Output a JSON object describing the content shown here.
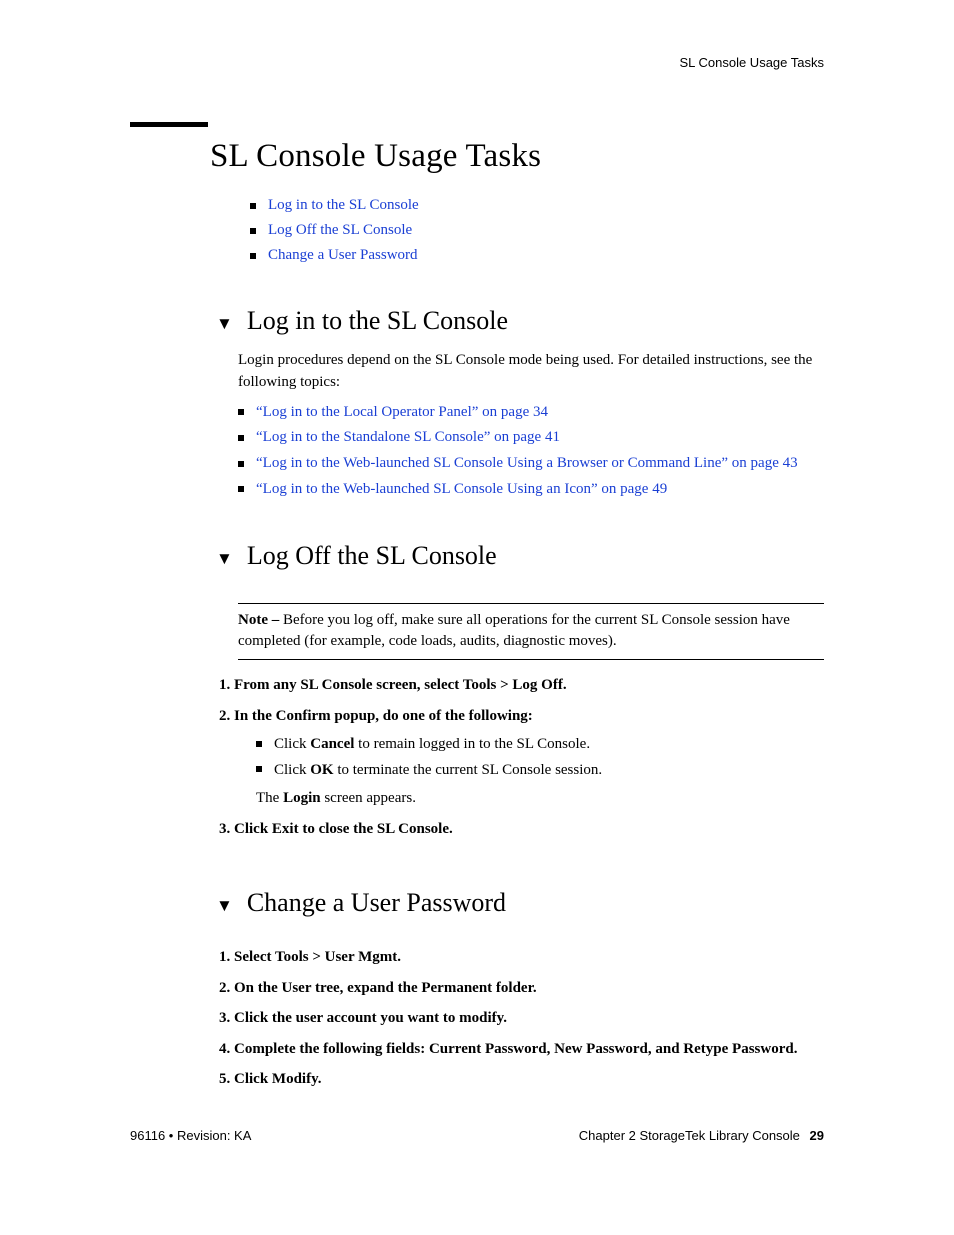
{
  "running_header": "SL Console Usage Tasks",
  "title": "SL Console Usage Tasks",
  "toc_links": [
    "Log in to the SL Console",
    "Log Off the SL Console",
    "Change a User Password"
  ],
  "section_login": {
    "heading": "Log in to the SL Console",
    "intro": "Login procedures depend on the SL Console mode being used. For detailed instructions, see the following topics:",
    "links": [
      "“Log in to the Local Operator Panel” on page 34",
      "“Log in to the Standalone SL Console” on page 41",
      "“Log in to the Web-launched SL Console Using a Browser or Command Line” on page 43",
      "“Log in to the Web-launched SL Console Using an Icon” on page 49"
    ]
  },
  "section_logoff": {
    "heading": "Log Off the SL Console",
    "note_label": "Note – ",
    "note_body": "Before you log off, make sure all operations for the current SL Console session have completed (for example, code loads, audits, diagnostic moves).",
    "step1": "From any SL Console screen, select Tools > Log Off.",
    "step2": "In the Confirm popup, do one of the following:",
    "step2_sub": [
      {
        "pre": "Click ",
        "bold": "Cancel",
        "post": " to remain logged in to the SL Console."
      },
      {
        "pre": "Click ",
        "bold": "OK",
        "post": " to terminate the current SL Console session."
      }
    ],
    "step2_trail_pre": "The ",
    "step2_trail_bold": "Login",
    "step2_trail_post": " screen appears.",
    "step3": "Click Exit to close the SL Console."
  },
  "section_password": {
    "heading": "Change a User Password",
    "steps": [
      "Select Tools > User Mgmt.",
      "On the User tree, expand the Permanent folder.",
      "Click the user account you want to modify.",
      "Complete the following fields: Current Password, New Password, and Retype Password.",
      "Click Modify."
    ]
  },
  "footer": {
    "left": "96116 • Revision: KA",
    "right_label": "Chapter 2 StorageTek Library Console",
    "page_number": "29"
  }
}
